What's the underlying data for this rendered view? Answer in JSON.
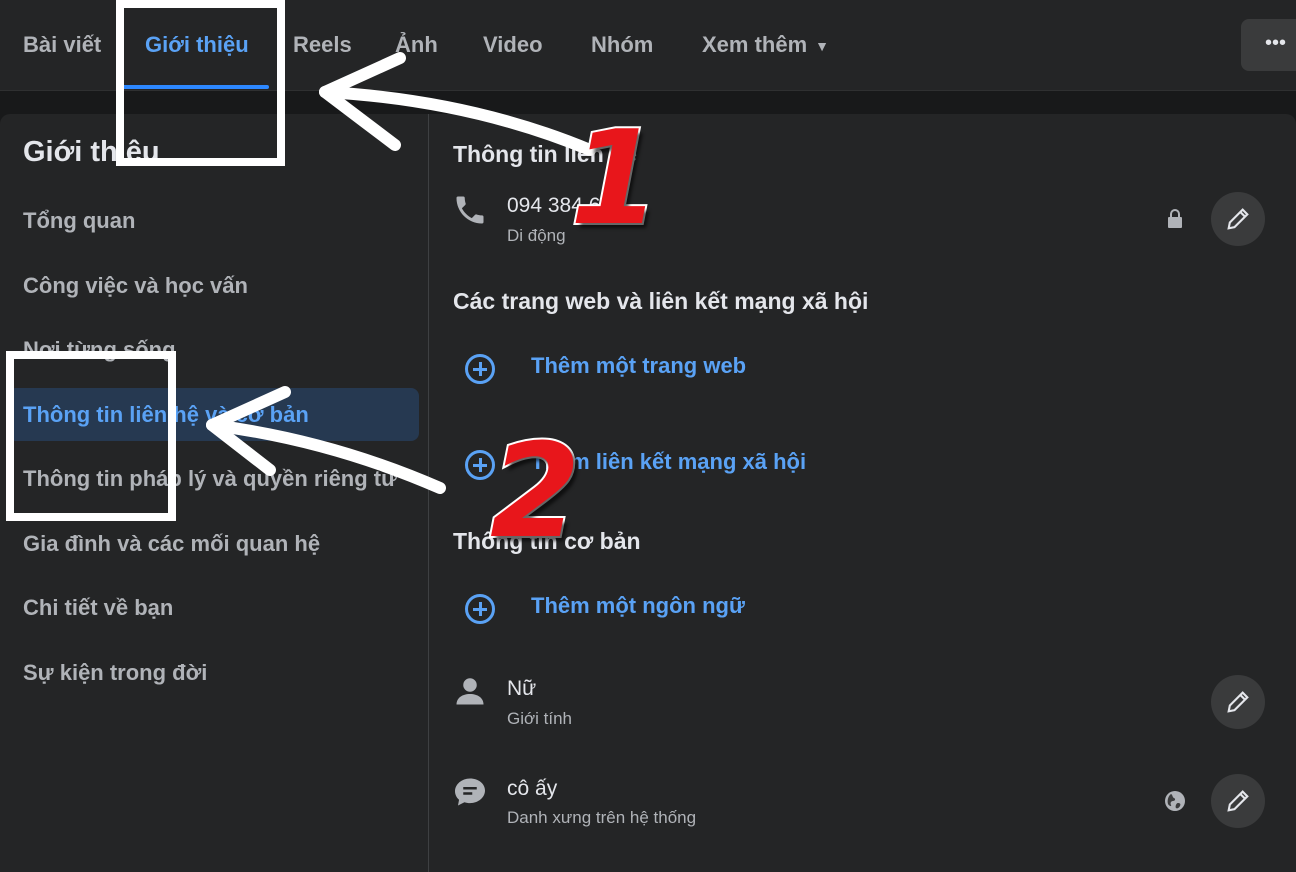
{
  "tabs": [
    {
      "label": "Bài viết"
    },
    {
      "label": "Giới thiệu",
      "active": true
    },
    {
      "label": "Reels"
    },
    {
      "label": "Ảnh"
    },
    {
      "label": "Video"
    },
    {
      "label": "Nhóm"
    },
    {
      "label": "Xem thêm"
    }
  ],
  "more_button": {
    "label": "•••"
  },
  "sidebar": {
    "title": "Giới thiệu",
    "items": [
      {
        "label": "Tổng quan"
      },
      {
        "label": "Công việc và học vấn"
      },
      {
        "label": "Nơi từng sống"
      },
      {
        "label": "Thông tin liên hệ và cơ bản",
        "active": true
      },
      {
        "label": "Thông tin pháp lý và quyền riêng tư"
      },
      {
        "label": "Gia đình và các mối quan hệ"
      },
      {
        "label": "Chi tiết về bạn"
      },
      {
        "label": "Sự kiện trong đời"
      }
    ]
  },
  "contact": {
    "title": "Thông tin liên hệ",
    "phone": "094 384 6  81",
    "phone_type": "Di động"
  },
  "websites": {
    "title": "Các trang web và liên kết mạng xã hội",
    "add_website": "Thêm một trang web",
    "add_social": "Thêm liên kết mạng xã hội"
  },
  "basic": {
    "title": "Thông tin cơ bản",
    "add_language": "Thêm một ngôn ngữ",
    "gender_value": "Nữ",
    "gender_label": "Giới tính",
    "pronoun_value": "cô ấy",
    "pronoun_label": "Danh xưng trên hệ thống"
  },
  "annotations": {
    "step1": "1",
    "step2": "2"
  },
  "colors": {
    "accent": "#5aa2f5",
    "annotation_red": "#e8161b"
  }
}
